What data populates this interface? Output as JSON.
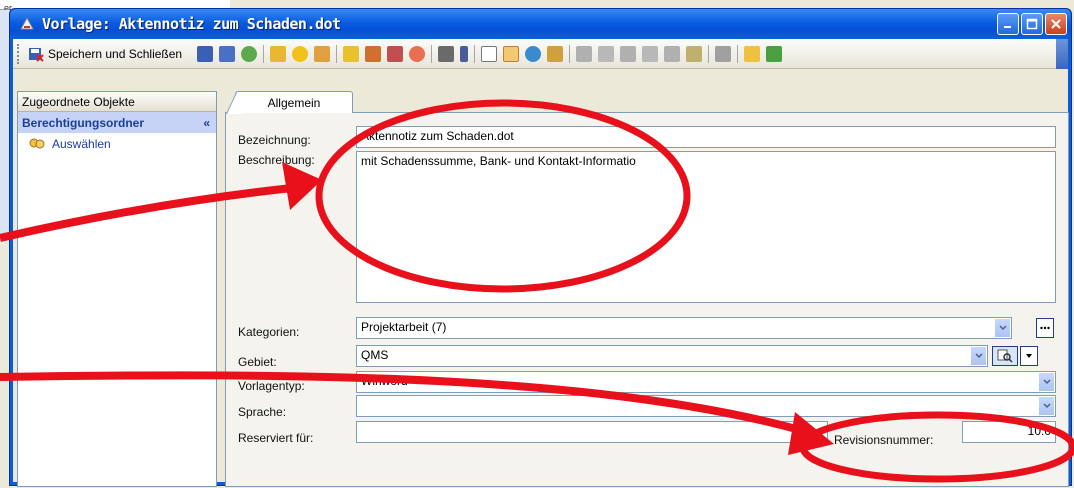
{
  "window": {
    "title": "Vorlage: Aktennotiz zum Schaden.dot",
    "background_fragment": "er"
  },
  "toolbar": {
    "save_close_label": "Speichern und Schließen"
  },
  "sidebar": {
    "header": "Zugeordnete Objekte",
    "group_title": "Berechtigungsordner",
    "group_toggle": "«",
    "item_label": "Auswählen"
  },
  "tabs": [
    {
      "label": "Allgemein"
    }
  ],
  "form": {
    "bezeichnung_label": "Bezeichnung:",
    "bezeichnung_value": "Aktennotiz zum Schaden.dot",
    "beschreibung_label": "Beschreibung:",
    "beschreibung_value": "mit Schadenssumme, Bank- und Kontakt-Informatio",
    "kategorien_label": "Kategorien:",
    "kategorien_value": "Projektarbeit (7)",
    "gebiet_label": "Gebiet:",
    "gebiet_value": "QMS",
    "vorlagentyp_label": "Vorlagentyp:",
    "vorlagentyp_value": "Winword",
    "sprache_label": "Sprache:",
    "sprache_value": "",
    "reserviert_label": "Reserviert für:",
    "reserviert_value": "",
    "revisionsnummer_label": "Revisionsnummer:",
    "revisionsnummer_value": "10.0"
  },
  "colors": {
    "annotation": "#e8101a",
    "title_bar": "#0a5fd6",
    "link_text": "#1b3ca0"
  }
}
